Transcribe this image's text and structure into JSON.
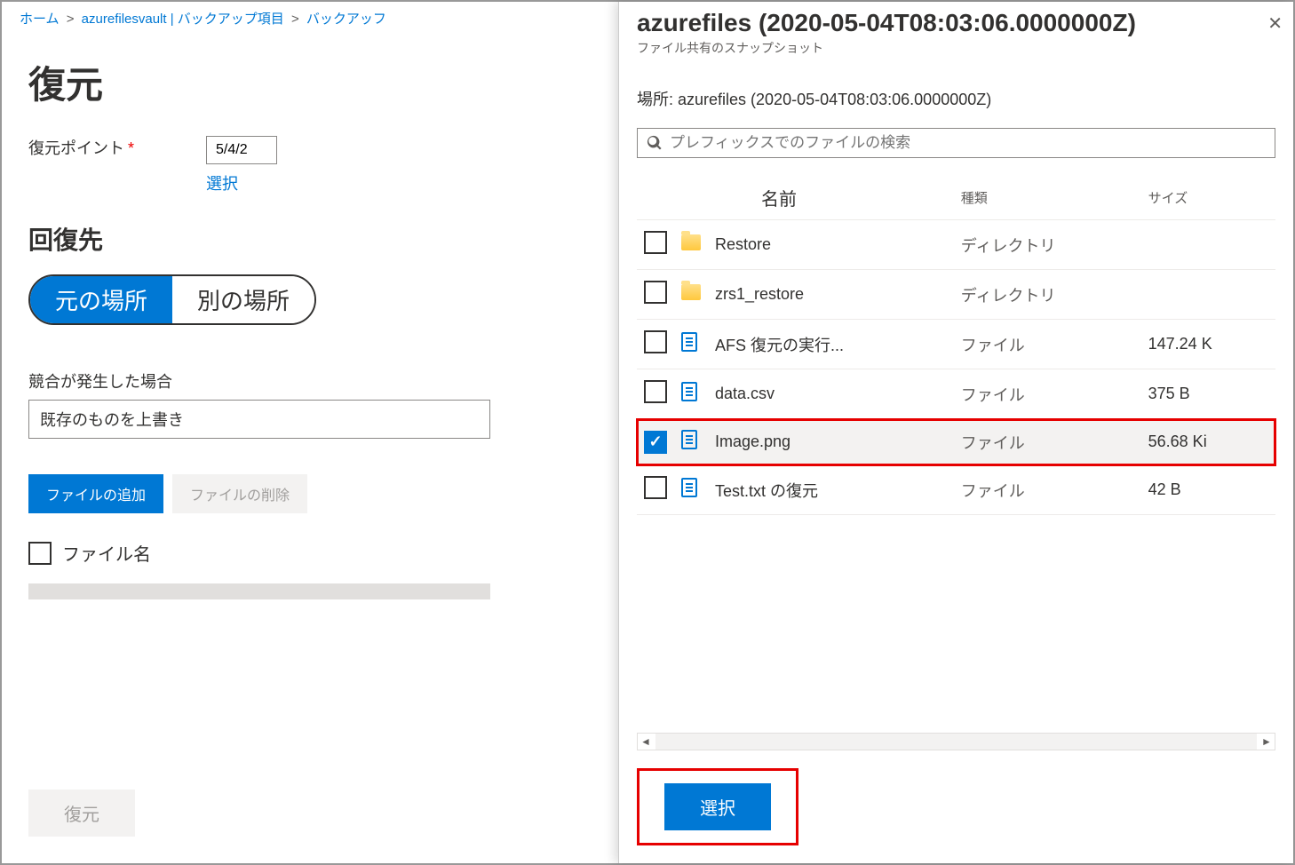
{
  "breadcrumb": {
    "home": "ホーム",
    "vault": "azurefilesvault | バックアップ項目",
    "backup": "バックアッフ"
  },
  "page": {
    "title": "復元",
    "restorePointLabel": "復元ポイント",
    "restorePointValue": "5/4/2",
    "selectLink": "選択",
    "recoverDestTitle": "回復先",
    "pillOriginal": "元の場所",
    "pillAlternate": "別の場所",
    "conflictLabel": "競合が発生した場合",
    "conflictValue": "既存のものを上書き",
    "addFileBtn": "ファイルの追加",
    "delFileBtn": "ファイルの削除",
    "fileNameLabel": "ファイル名",
    "restoreBtn": "復元"
  },
  "blade": {
    "title": "azurefiles (2020-05-04T08:03:06.0000000Z)",
    "subtitle": "ファイル共有のスナップショット",
    "locationLabel": "場所: azurefiles (2020-05-04T08:03:06.0000000Z)",
    "searchPlaceholder": "プレフィックスでのファイルの検索",
    "colName": "名前",
    "colType": "種類",
    "colSize": "サイズ",
    "selectBtn": "選択",
    "rows": [
      {
        "name": "Restore",
        "type": "ディレクトリ",
        "size": "",
        "icon": "folder",
        "checked": false
      },
      {
        "name": "zrs1_restore",
        "type": "ディレクトリ",
        "size": "",
        "icon": "folder",
        "checked": false
      },
      {
        "name": "AFS 復元の実行...",
        "type": "ファイル",
        "size": "147.24 K",
        "icon": "file",
        "checked": false
      },
      {
        "name": "data.csv",
        "type": "ファイル",
        "size": "375 B",
        "icon": "file",
        "checked": false
      },
      {
        "name": "Image.png",
        "type": "ファイル",
        "size": "56.68 Ki",
        "icon": "file",
        "checked": true,
        "highlight": true
      },
      {
        "name": "Test.txt の復元",
        "type": "ファイル",
        "size": "42 B",
        "icon": "file",
        "checked": false
      }
    ]
  }
}
